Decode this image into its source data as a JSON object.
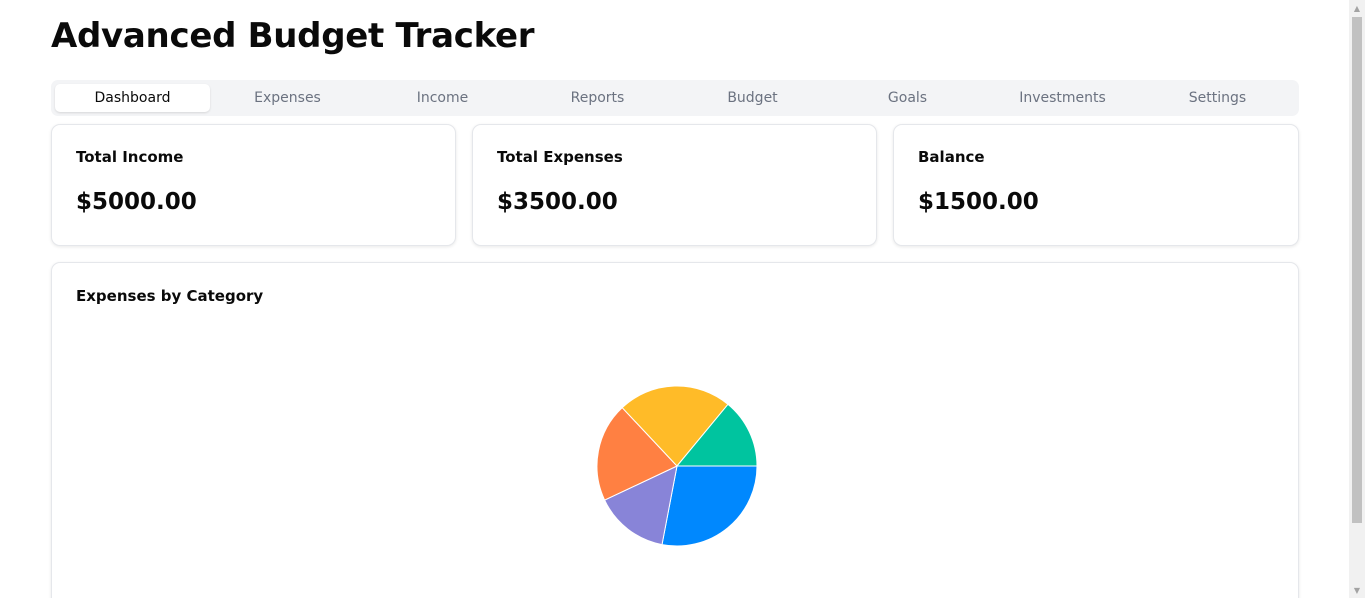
{
  "app": {
    "title": "Advanced Budget Tracker"
  },
  "tabs": [
    {
      "label": "Dashboard",
      "active": true
    },
    {
      "label": "Expenses",
      "active": false
    },
    {
      "label": "Income",
      "active": false
    },
    {
      "label": "Reports",
      "active": false
    },
    {
      "label": "Budget",
      "active": false
    },
    {
      "label": "Goals",
      "active": false
    },
    {
      "label": "Investments",
      "active": false
    },
    {
      "label": "Settings",
      "active": false
    }
  ],
  "stats": {
    "income": {
      "label": "Total Income",
      "value": "$5000.00"
    },
    "expenses": {
      "label": "Total Expenses",
      "value": "$3500.00"
    },
    "balance": {
      "label": "Balance",
      "value": "$1500.00"
    }
  },
  "expenses_chart": {
    "label": "Expenses by Category"
  },
  "chart_data": {
    "type": "pie",
    "title": "Expenses by Category",
    "slices": [
      {
        "value": 28,
        "color": "#0088FE"
      },
      {
        "value": 15,
        "color": "#8884D8"
      },
      {
        "value": 20,
        "color": "#FF8042"
      },
      {
        "value": 23,
        "color": "#FFBB28"
      },
      {
        "value": 14,
        "color": "#00C49F"
      }
    ]
  },
  "colors": {
    "tab_bar_bg": "#f3f4f6",
    "card_border": "#e5e7eb",
    "muted_text": "#6b7280"
  }
}
